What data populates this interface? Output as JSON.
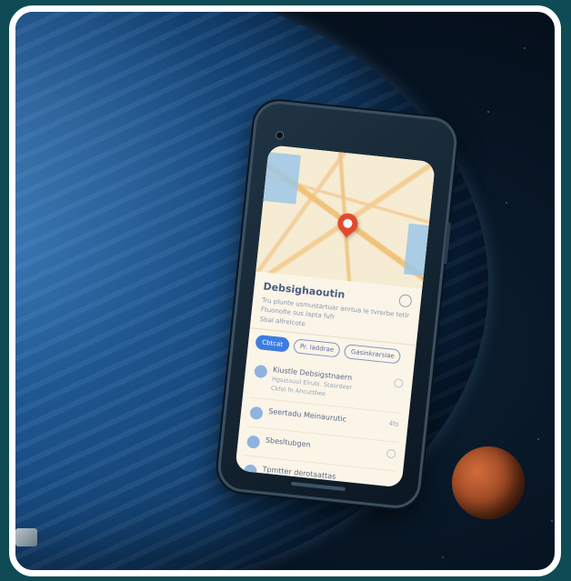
{
  "background": {
    "frame_color": "#ffffff",
    "planet_colors": [
      "#2a6aa8",
      "#103a66"
    ],
    "moon_color": "#a04a24"
  },
  "phone": {
    "map": {
      "pin_icon": "map-pin-icon"
    },
    "place": {
      "title": "Debsighaoutin",
      "description": "Tru plunte usmustartuar anrtua le tvrerbe tetlr Ftuonolte sus lapta fufr",
      "meta": "Sbal alfrelcote",
      "share_icon": "share-icon"
    },
    "chips": [
      {
        "label": "Cbtcat",
        "primary": true
      },
      {
        "label": "Pr. laddrae",
        "primary": false
      },
      {
        "label": "Gasinkrarsiae",
        "primary": false
      }
    ],
    "list": [
      {
        "title": "Kiustle Debsigstnaern",
        "sub": "Hgsstouul Elrubi. Stasrdeer",
        "sub2": "Ckfol fn Ahcuttbee",
        "trail": ""
      },
      {
        "title": "Seertadu Meinaurutic",
        "sub": "",
        "trail": "4ts"
      },
      {
        "title": "Sbesltubgen",
        "sub": "",
        "trail": ""
      },
      {
        "title": "Tpmtter derotaattas",
        "sub": "",
        "trail": ""
      }
    ]
  }
}
